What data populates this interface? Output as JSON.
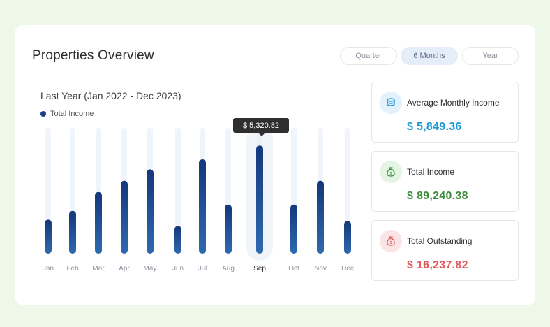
{
  "header": {
    "title": "Properties Overview",
    "segments": [
      {
        "label": "Quarter",
        "active": false
      },
      {
        "label": "6 Months",
        "active": true
      },
      {
        "label": "Year",
        "active": false
      }
    ]
  },
  "chart": {
    "subtitle": "Last Year (Jan 2022 - Dec 2023)",
    "legend_label": "Total Income",
    "tooltip": "$ 5,320.82",
    "highlighted": "Sep"
  },
  "chart_data": {
    "type": "bar",
    "categories": [
      "Jan",
      "Feb",
      "Mar",
      "Apr",
      "May",
      "Jun",
      "Jul",
      "Aug",
      "Sep",
      "Oct",
      "Nov",
      "Dec"
    ],
    "values": [
      27,
      34,
      49,
      58,
      67,
      22,
      75,
      39,
      86,
      39,
      58,
      26
    ],
    "ylim": [
      0,
      100
    ],
    "colors": {
      "bar_top": "#15377a",
      "bar_bottom": "#2e6ab0",
      "track": "#f0f4fb",
      "highlight_track": "#f1f4f8"
    }
  },
  "stats": [
    {
      "label": "Average Monthly Income",
      "value": "$ 5,849.36",
      "icon": "coins-icon",
      "color": "#1e98d6",
      "icon_bg": "#e2f1fb"
    },
    {
      "label": "Total Income",
      "value": "$ 89,240.38",
      "icon": "money-bag-icon",
      "color": "#3e8d3c",
      "icon_bg": "#e4f5e3"
    },
    {
      "label": "Total Outstanding",
      "value": "$ 16,237.82",
      "icon": "money-bag-icon",
      "color": "#e05a5a",
      "icon_bg": "#fbe4e4"
    }
  ]
}
